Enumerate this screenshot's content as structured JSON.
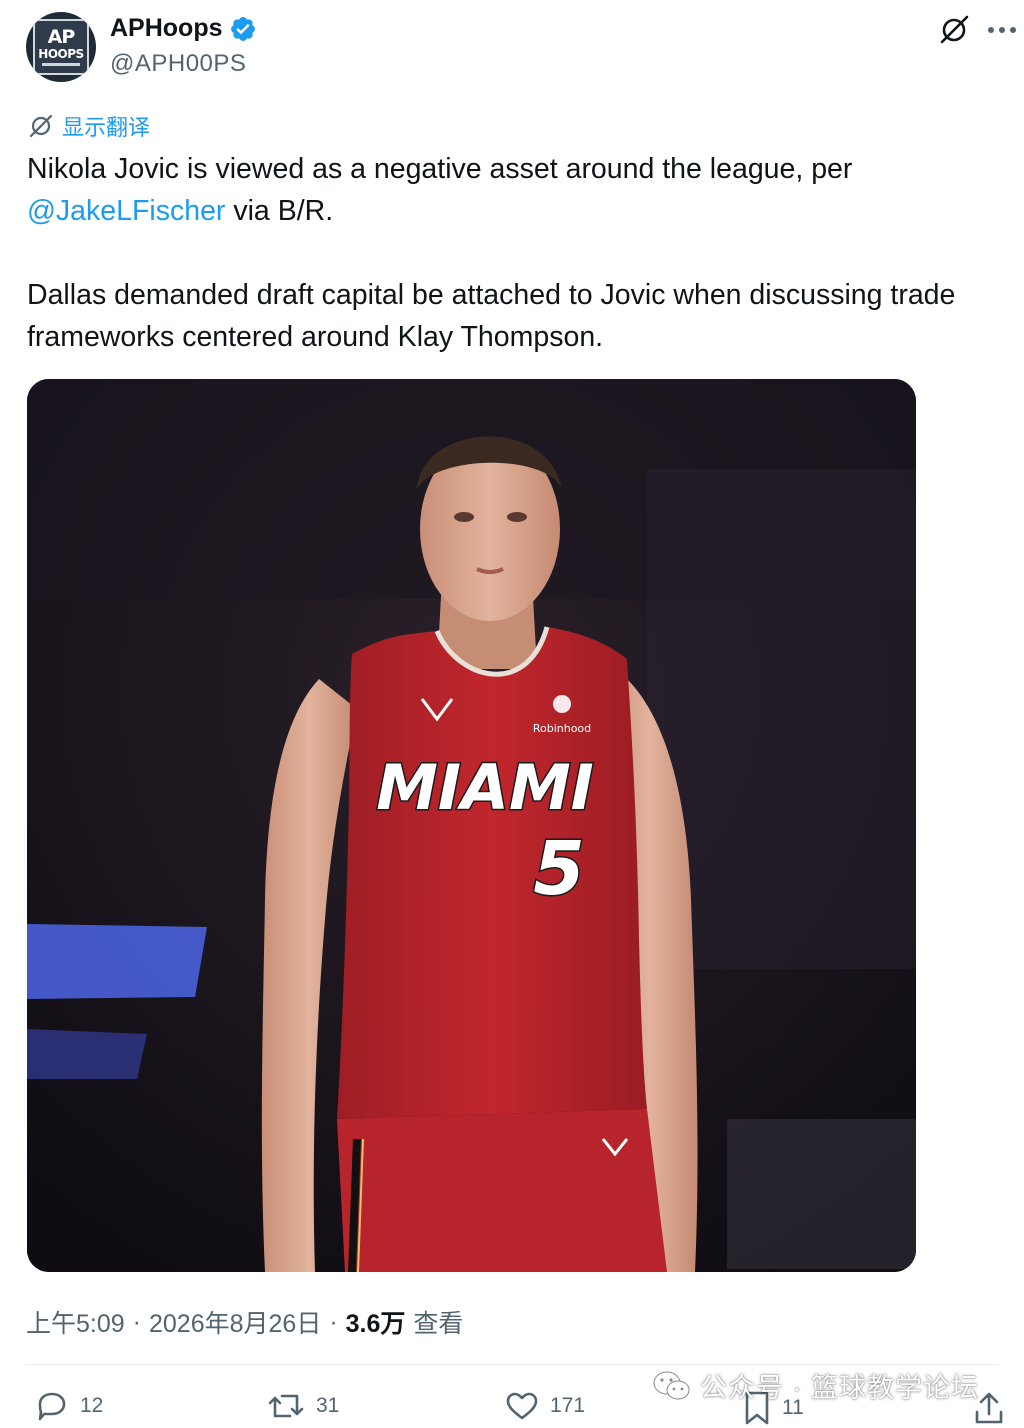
{
  "tweet": {
    "author": {
      "display_name": "APHoops",
      "handle": "@APH00PS",
      "verified": true,
      "avatar_text_top": "AP",
      "avatar_text_bottom": "HOOPS"
    },
    "header_icons": [
      "grok-icon",
      "more-icon"
    ],
    "translate_label": "显示翻译",
    "text": {
      "line1_before": "Nikola Jovic is viewed as a negative asset around the league, per ",
      "mention": "@JakeLFischer",
      "line1_after": " via B/R.",
      "paragraph2": "Dallas demanded draft capital be attached to Jovic when discussing trade frameworks centered around Klay Thompson."
    },
    "media": {
      "jersey_team": "MIAMI",
      "jersey_number": "5",
      "jersey_sponsor": "Robinhood"
    },
    "meta": {
      "time": "上午5:09",
      "sep1": "·",
      "date": "2026年8月26日",
      "sep2": "·",
      "views_count": "3.6万",
      "views_label": "查看"
    },
    "actions": {
      "replies": "12",
      "retweets": "31",
      "likes": "171",
      "bookmarks": "11"
    },
    "watermark": "公众号 · 篮球教学论坛",
    "colors": {
      "link": "#1d9bf0",
      "text": "#0f1419",
      "secondary": "#536471",
      "jersey": "#c1272d"
    }
  }
}
